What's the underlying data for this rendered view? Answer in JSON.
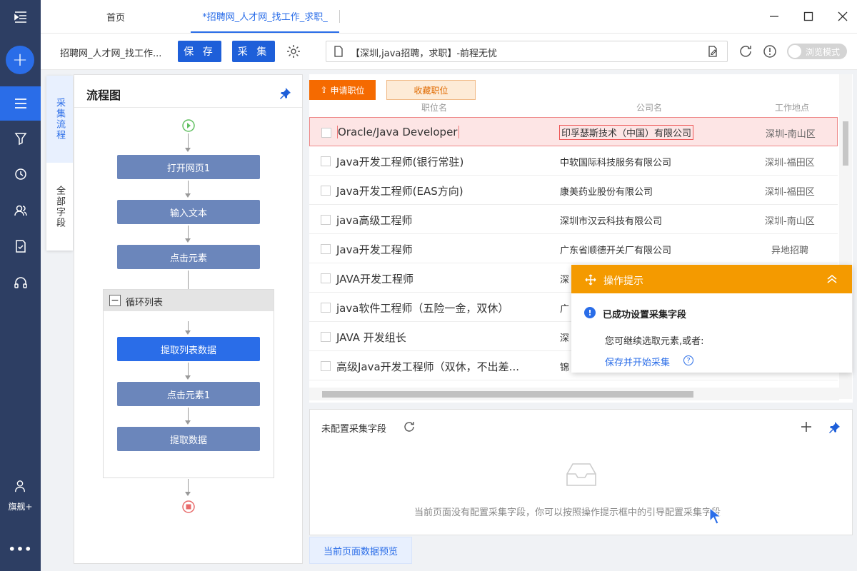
{
  "tabs": {
    "home": "首页",
    "active": "*招聘网_人才网_找工作_求职_"
  },
  "toolbar": {
    "task_name": "招聘网_人才网_找工作...",
    "save_label": "保 存",
    "collect_label": "采 集",
    "url_text": "【深圳,java招聘，求职】-前程无忧",
    "browse_mode_label": "浏览模式"
  },
  "sidebar": {
    "user_label": "旗舰+",
    "more_label": "•••"
  },
  "side_tabs": {
    "process": "采集流程",
    "all_fields": "全部字段"
  },
  "flow": {
    "title": "流程图",
    "nodes": [
      "打开网页1",
      "输入文本",
      "点击元素",
      "提取列表数据",
      "点击元素1",
      "提取数据"
    ],
    "loop_label": "循环列表",
    "loop_toggle": "−"
  },
  "webpage": {
    "apply_btn": "申请职位",
    "fav_btn": "收藏职位",
    "col_headers": [
      "职位名",
      "公司名",
      "工作地点"
    ],
    "rows": [
      {
        "job": "Oracle/Java Developer",
        "company": "印孚瑟斯技术（中国）有限公司",
        "location": "深圳-南山区"
      },
      {
        "job": "Java开发工程师(银行常驻)",
        "company": "中软国际科技服务有限公司",
        "location": "深圳-福田区"
      },
      {
        "job": "Java开发工程师(EAS方向)",
        "company": "康美药业股份有限公司",
        "location": "深圳-福田区"
      },
      {
        "job": "java高级工程师",
        "company": "深圳市汉云科技有限公司",
        "location": "深圳-南山区"
      },
      {
        "job": "Java开发工程师",
        "company": "广东省顺德开关厂有限公司",
        "location": "异地招聘"
      },
      {
        "job": "JAVA开发工程师",
        "company": "深",
        "location": ""
      },
      {
        "job": "java软件工程师（五险一金，双休）",
        "company": "广",
        "location": ""
      },
      {
        "job": "JAVA 开发组长",
        "company": "深",
        "location": ""
      },
      {
        "job": "高级Java开发工程师（双休，不出差...",
        "company": "锦",
        "location": ""
      }
    ]
  },
  "tip": {
    "title": "操作提示",
    "info_glyph": "!",
    "main": "已成功设置采集字段",
    "sub": "您可继续选取元素,或者:",
    "link": "保存并开始采集",
    "help_glyph": "?"
  },
  "fields": {
    "title": "未配置采集字段",
    "empty_message": "当前页面没有配置采集字段，你可以按照操作提示框中的引导配置采集字段",
    "preview_tab": "当前页面数据预览"
  },
  "colors": {
    "accent": "#2a6de8",
    "nav_bg": "#2d3e63",
    "tip_orange": "#f49a00",
    "flow_node": "#6b86bb"
  }
}
